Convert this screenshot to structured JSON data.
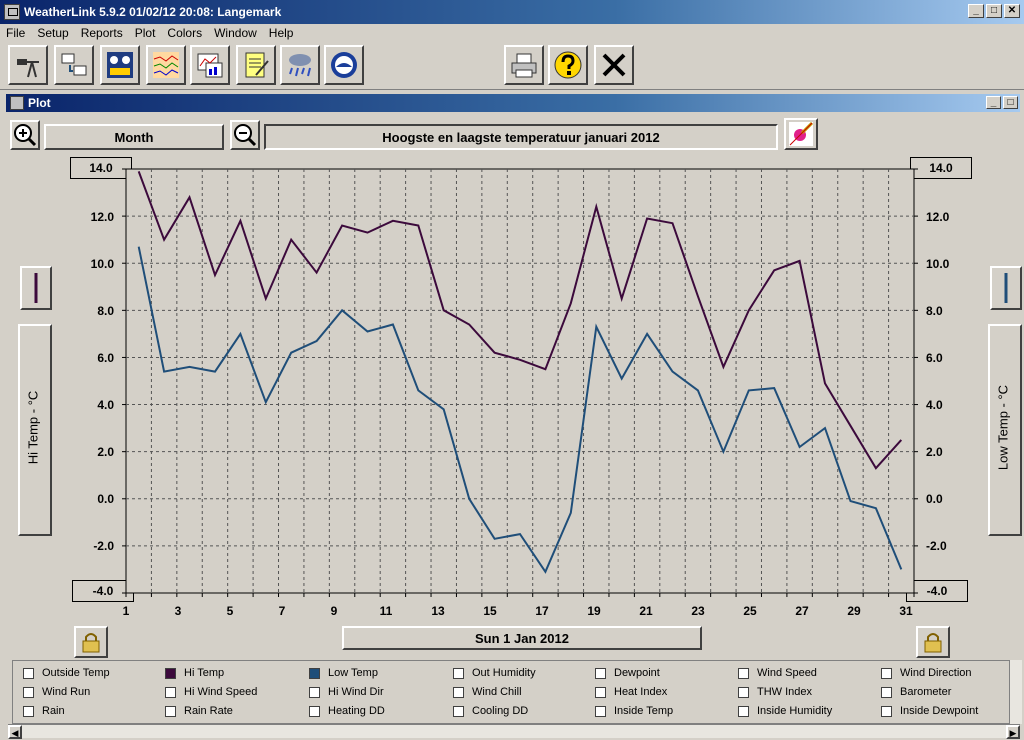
{
  "window": {
    "title": "WeatherLink 5.9.2  01/02/12  20:08: Langemark",
    "min": "_",
    "max": "□",
    "close": "✕"
  },
  "menu": [
    "File",
    "Setup",
    "Reports",
    "Plot",
    "Colors",
    "Window",
    "Help"
  ],
  "toolbar": {
    "icons": [
      "station-icon",
      "download-icon",
      "bulletin-icon",
      "strip-chart-icon",
      "plot-icon",
      "notes-icon",
      "rain-icon",
      "noaa-icon",
      "print-icon",
      "help-icon",
      "close-icon"
    ]
  },
  "plot_window": {
    "title": "Plot"
  },
  "controls": {
    "zoom_in": "+",
    "zoom_out": "−",
    "period": "Month",
    "plot_title": "Hoogste en laagste temperatuur januari 2012",
    "date_button": "Sun 1 Jan 2012"
  },
  "axes": {
    "left_max_box": "14.0",
    "left_min_box": "-4.0",
    "right_max_box": "14.0",
    "right_min_box": "-4.0",
    "left_label": "Hi Temp - °C",
    "right_label": "Low Temp - °C",
    "y_ticks": [
      "12.0",
      "10.0",
      "8.0",
      "6.0",
      "4.0",
      "2.0",
      "0.0",
      "-2.0"
    ],
    "x_ticks": [
      "1",
      "3",
      "5",
      "7",
      "9",
      "11",
      "13",
      "15",
      "17",
      "19",
      "21",
      "23",
      "25",
      "27",
      "29",
      "31"
    ]
  },
  "chart_data": {
    "type": "line",
    "title": "Hoogste en laagste temperatuur januari 2012",
    "xlabel": "",
    "ylabel": "Hi Temp - °C",
    "y2label": "Low Temp - °C",
    "xlim": [
      1,
      32
    ],
    "ylim": [
      -4.0,
      14.0
    ],
    "grid": true,
    "x": [
      1.5,
      2.5,
      3.5,
      4.5,
      5.5,
      6.5,
      7.5,
      8.5,
      9.5,
      10.5,
      11.5,
      12.5,
      13.5,
      14.5,
      15.5,
      16.5,
      17.5,
      18.5,
      19.5,
      20.5,
      21.5,
      22.5,
      23.5,
      24.5,
      25.5,
      26.5,
      27.5,
      28.5,
      29.5,
      30.5,
      31.5
    ],
    "series": [
      {
        "name": "Hi Temp",
        "color": "#3c0a3c",
        "values": [
          13.9,
          11.0,
          12.8,
          9.5,
          11.8,
          8.5,
          11.0,
          9.6,
          11.6,
          11.3,
          11.8,
          11.6,
          8.0,
          7.4,
          6.2,
          5.9,
          5.5,
          8.3,
          12.4,
          8.5,
          11.9,
          11.7,
          8.6,
          5.6,
          8.0,
          9.7,
          10.1,
          4.9,
          3.1,
          1.3,
          2.5
        ]
      },
      {
        "name": "Low Temp",
        "color": "#1f4e79",
        "values": [
          10.7,
          5.4,
          5.6,
          5.4,
          7.0,
          4.1,
          6.2,
          6.7,
          8.0,
          7.1,
          7.4,
          4.6,
          3.8,
          0.0,
          -1.7,
          -1.5,
          -3.1,
          -0.6,
          7.3,
          5.1,
          7.0,
          5.4,
          4.6,
          2.0,
          4.6,
          4.7,
          2.2,
          3.0,
          -0.1,
          -0.4,
          -3.0
        ]
      }
    ]
  },
  "legend": {
    "items": [
      {
        "label": "Outside Temp",
        "swatch": ""
      },
      {
        "label": "Hi Temp",
        "swatch": "#3c0a3c"
      },
      {
        "label": "Low Temp",
        "swatch": "#1f4e79"
      },
      {
        "label": "Out Humidity",
        "swatch": ""
      },
      {
        "label": "Dewpoint",
        "swatch": ""
      },
      {
        "label": "Wind Speed",
        "swatch": ""
      },
      {
        "label": "Wind Direction",
        "swatch": ""
      },
      {
        "label": "Wind Run",
        "swatch": ""
      },
      {
        "label": "Hi Wind Speed",
        "swatch": ""
      },
      {
        "label": "Hi Wind Dir",
        "swatch": ""
      },
      {
        "label": "Wind Chill",
        "swatch": ""
      },
      {
        "label": "Heat Index",
        "swatch": ""
      },
      {
        "label": "THW Index",
        "swatch": ""
      },
      {
        "label": "Barometer",
        "swatch": ""
      },
      {
        "label": "Rain",
        "swatch": ""
      },
      {
        "label": "Rain Rate",
        "swatch": ""
      },
      {
        "label": "Heating DD",
        "swatch": ""
      },
      {
        "label": "Cooling DD",
        "swatch": ""
      },
      {
        "label": "Inside Temp",
        "swatch": ""
      },
      {
        "label": "Inside Humidity",
        "swatch": ""
      },
      {
        "label": "Inside Dewpoint",
        "swatch": ""
      }
    ]
  }
}
